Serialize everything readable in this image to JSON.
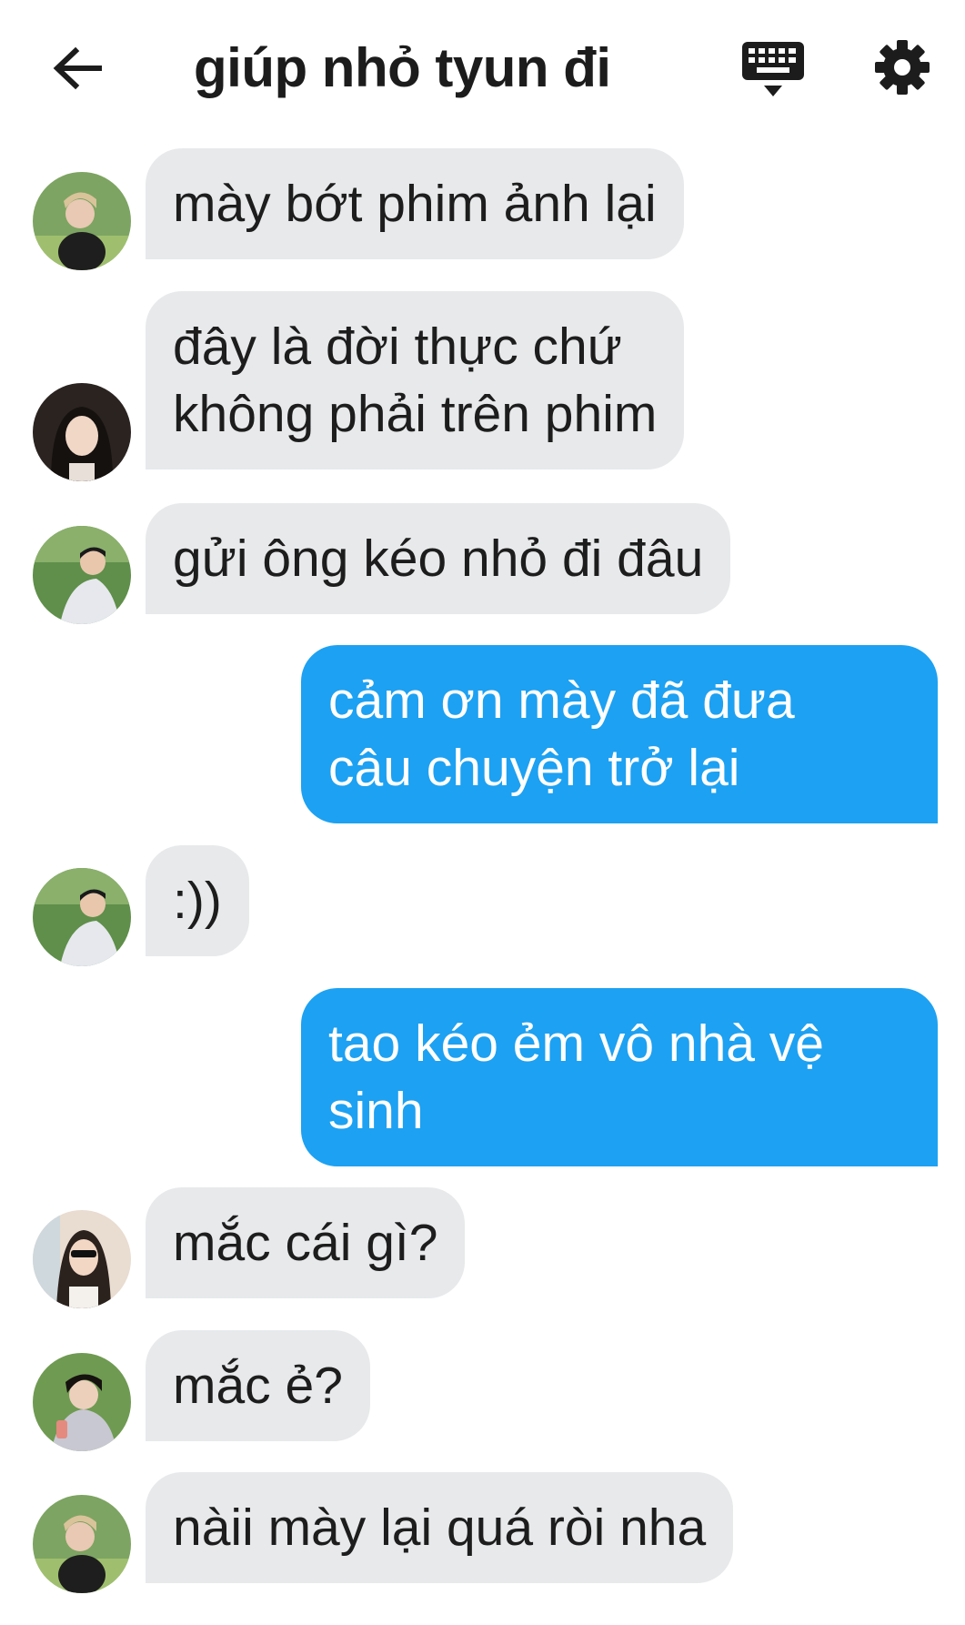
{
  "header": {
    "title": "giúp nhỏ tyun đi",
    "back_icon": "arrow-left-icon",
    "keyboard_icon": "keyboard-icon",
    "settings_icon": "gear-icon"
  },
  "colors": {
    "incoming_bubble": "#e7e9eb",
    "outgoing_bubble": "#1da1f2",
    "outgoing_text": "#ffffff",
    "incoming_text": "#1d1d1d"
  },
  "messages": [
    {
      "direction": "incoming",
      "text": "mày bớt phim ảnh lại"
    },
    {
      "direction": "incoming",
      "text": "đây là đời thực chứ\nkhông phải trên phim"
    },
    {
      "direction": "incoming",
      "text": "gửi ông kéo nhỏ đi đâu"
    },
    {
      "direction": "outgoing",
      "text": "cảm ơn mày đã đưa\ncâu chuyện trở lại"
    },
    {
      "direction": "incoming",
      "text": ":))"
    },
    {
      "direction": "outgoing",
      "text": "tao kéo ẻm vô nhà vệ\nsinh"
    },
    {
      "direction": "incoming",
      "text": "mắc cái gì?"
    },
    {
      "direction": "incoming",
      "text": "mắc ẻ?"
    },
    {
      "direction": "incoming",
      "text": "nàii mày lại quá ròi nha"
    }
  ]
}
